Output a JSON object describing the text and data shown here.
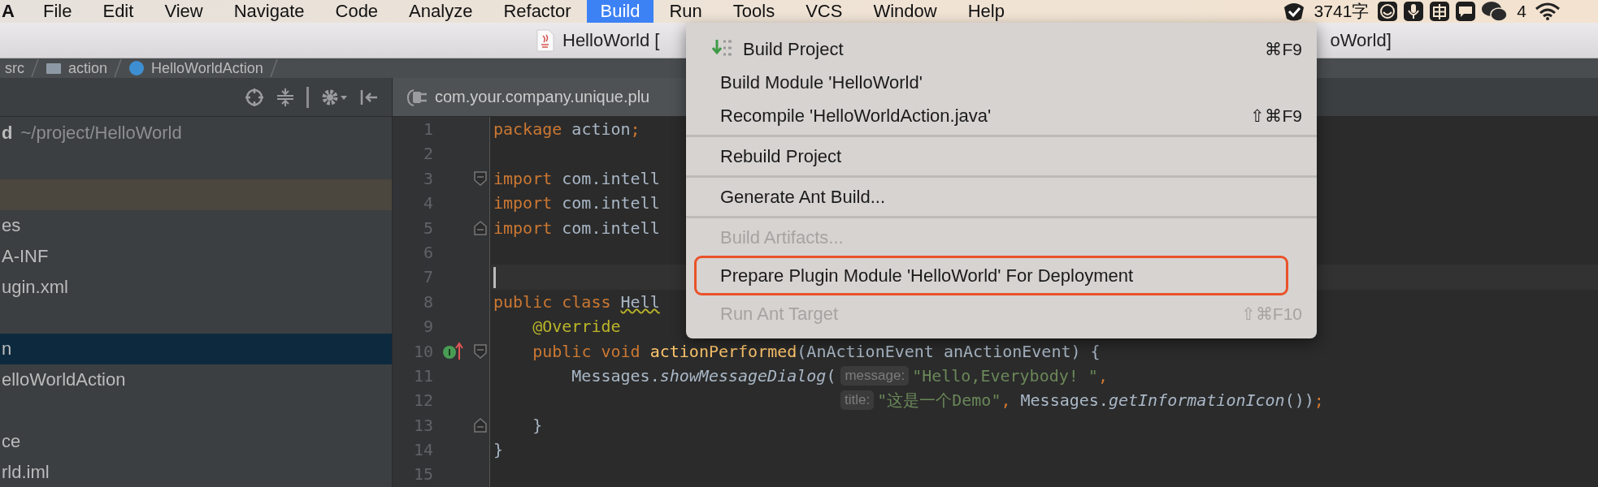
{
  "menu_bar": {
    "app": "A",
    "items": [
      {
        "label": "File",
        "selected": false
      },
      {
        "label": "Edit",
        "selected": false
      },
      {
        "label": "View",
        "selected": false
      },
      {
        "label": "Navigate",
        "selected": false
      },
      {
        "label": "Code",
        "selected": false
      },
      {
        "label": "Analyze",
        "selected": false
      },
      {
        "label": "Refactor",
        "selected": false
      },
      {
        "label": "Build",
        "selected": true
      },
      {
        "label": "Run",
        "selected": false
      },
      {
        "label": "Tools",
        "selected": false
      },
      {
        "label": "VCS",
        "selected": false
      },
      {
        "label": "Window",
        "selected": false
      },
      {
        "label": "Help",
        "selected": false
      }
    ],
    "word_count": "3741字",
    "message_count": "4"
  },
  "window": {
    "title": "HelloWorld [",
    "title_end": "oWorld]"
  },
  "breadcrumbs": [
    {
      "kind": "plain",
      "label": "src"
    },
    {
      "kind": "folder",
      "label": "action"
    },
    {
      "kind": "class",
      "label": "HelloWorldAction"
    }
  ],
  "editor_tab": {
    "label": "com.your.company.unique.plu"
  },
  "project_tree": {
    "rows": [
      {
        "kind": "root",
        "name": "d",
        "path": "~/project/HelloWorld",
        "selected": false,
        "highlighted": false
      },
      {
        "kind": "blank"
      },
      {
        "kind": "highlight"
      },
      {
        "kind": "node",
        "name": "es",
        "selected": false,
        "highlighted": false
      },
      {
        "kind": "node",
        "name": "A-INF",
        "selected": false,
        "highlighted": false
      },
      {
        "kind": "node",
        "name": "ugin.xml",
        "selected": false,
        "highlighted": false
      },
      {
        "kind": "blank"
      },
      {
        "kind": "node",
        "name": "n",
        "selected": true,
        "highlighted": false
      },
      {
        "kind": "node",
        "name": "elloWorldAction",
        "selected": false,
        "highlighted": false
      },
      {
        "kind": "blank"
      },
      {
        "kind": "node",
        "name": "ce",
        "selected": false,
        "highlighted": false
      },
      {
        "kind": "node",
        "name": "rld.iml",
        "selected": false,
        "highlighted": false
      }
    ]
  },
  "editor": {
    "lines": [
      {
        "number": "1",
        "kind": "top",
        "current": false,
        "implements": false,
        "fold_start": false,
        "fold_end": false,
        "tokens": [
          {
            "kind": "kw",
            "text": "package"
          },
          {
            "kind": "text",
            "text": " action"
          },
          {
            "kind": "kw",
            "text": ";"
          }
        ]
      },
      {
        "number": "2",
        "kind": "top",
        "current": false,
        "implements": false,
        "fold_start": false,
        "fold_end": false
      },
      {
        "number": "3",
        "kind": "top",
        "current": false,
        "implements": false,
        "fold_start": true,
        "fold_end": false,
        "tokens": [
          {
            "kind": "kw",
            "text": "import"
          },
          {
            "kind": "text",
            "text": " com.intell"
          }
        ]
      },
      {
        "number": "4",
        "kind": "top",
        "current": false,
        "implements": false,
        "fold_start": false,
        "fold_end": false,
        "tokens": [
          {
            "kind": "kw",
            "text": "import"
          },
          {
            "kind": "text",
            "text": " com.intell"
          }
        ]
      },
      {
        "number": "5",
        "kind": "top",
        "current": false,
        "implements": false,
        "fold_start": false,
        "fold_end": true,
        "tokens": [
          {
            "kind": "kw",
            "text": "import"
          },
          {
            "kind": "text",
            "text": " com.intell"
          }
        ]
      },
      {
        "number": "6",
        "kind": "top",
        "current": false,
        "implements": false,
        "fold_start": false,
        "fold_end": false
      },
      {
        "number": "7",
        "kind": "top",
        "current": true,
        "implements": false,
        "fold_start": false,
        "fold_end": false
      },
      {
        "number": "8",
        "kind": "top",
        "current": false,
        "implements": false,
        "fold_start": false,
        "fold_end": false,
        "tokens": [
          {
            "kind": "kw",
            "text": "public class "
          },
          {
            "kind": "warn",
            "text": "Hell"
          }
        ]
      },
      {
        "number": "9",
        "kind": "member",
        "current": false,
        "implements": false,
        "fold_start": false,
        "fold_end": false,
        "tokens": [
          {
            "kind": "ann",
            "text": "@Override"
          }
        ]
      },
      {
        "number": "10",
        "kind": "member",
        "current": false,
        "implements": true,
        "fold_start": true,
        "fold_end": false,
        "tokens": [
          {
            "kind": "kw",
            "text": "public void "
          },
          {
            "kind": "fn",
            "text": "actionPerformed"
          },
          {
            "kind": "text",
            "text": "(AnActionEvent anActionEvent) {"
          }
        ]
      },
      {
        "number": "11",
        "kind": "body",
        "current": false,
        "implements": false,
        "fold_start": false,
        "fold_end": false,
        "tokens": [
          {
            "kind": "text",
            "text": "Messages."
          },
          {
            "kind": "italic",
            "text": "showMessageDialog"
          },
          {
            "kind": "text",
            "text": "("
          },
          {
            "kind": "hint",
            "text": "message:"
          },
          {
            "kind": "str",
            "text": "\"Hello,Everybody! \""
          },
          {
            "kind": "kw",
            "text": ","
          }
        ]
      },
      {
        "number": "12",
        "kind": "continuation",
        "current": false,
        "implements": false,
        "fold_start": false,
        "fold_end": false,
        "tokens": [
          {
            "kind": "hint",
            "text": "title:"
          },
          {
            "kind": "str",
            "text": "\"这是一个Demo\""
          },
          {
            "kind": "kw",
            "text": ", "
          },
          {
            "kind": "text",
            "text": "Messages."
          },
          {
            "kind": "italic",
            "text": "getInformationIcon"
          },
          {
            "kind": "text",
            "text": "())"
          },
          {
            "kind": "kw",
            "text": ";"
          }
        ]
      },
      {
        "number": "13",
        "kind": "member",
        "current": false,
        "implements": false,
        "fold_start": false,
        "fold_end": true,
        "tokens": [
          {
            "kind": "text",
            "text": "}"
          }
        ]
      },
      {
        "number": "14",
        "kind": "top",
        "current": false,
        "implements": false,
        "fold_start": false,
        "fold_end": false,
        "tokens": [
          {
            "kind": "text",
            "text": "}"
          }
        ]
      },
      {
        "number": "15",
        "kind": "top",
        "current": false,
        "implements": false,
        "fold_start": false,
        "fold_end": false
      }
    ]
  },
  "build_menu": {
    "items": [
      {
        "kind": "icon-item",
        "label": "Build Project",
        "shortcut": "⌘F9",
        "disabled": false,
        "annotated": false
      },
      {
        "kind": "item",
        "label": "Build Module 'HelloWorld'",
        "disabled": false,
        "annotated": false
      },
      {
        "kind": "item",
        "label": "Recompile 'HelloWorldAction.java'",
        "shortcut": "⇧⌘F9",
        "disabled": false,
        "annotated": false
      },
      {
        "kind": "separator"
      },
      {
        "kind": "item",
        "label": "Rebuild Project",
        "disabled": false,
        "annotated": false
      },
      {
        "kind": "separator"
      },
      {
        "kind": "item",
        "label": "Generate Ant Build...",
        "disabled": false,
        "annotated": false
      },
      {
        "kind": "separator"
      },
      {
        "kind": "item",
        "label": "Build Artifacts...",
        "disabled": true,
        "annotated": false
      },
      {
        "kind": "item",
        "label": "Prepare Plugin Module 'HelloWorld' For Deployment",
        "disabled": false,
        "annotated": true
      },
      {
        "kind": "item",
        "label": "Run Ant Target",
        "shortcut": "⇧⌘F10",
        "disabled": true,
        "annotated": false
      }
    ]
  }
}
